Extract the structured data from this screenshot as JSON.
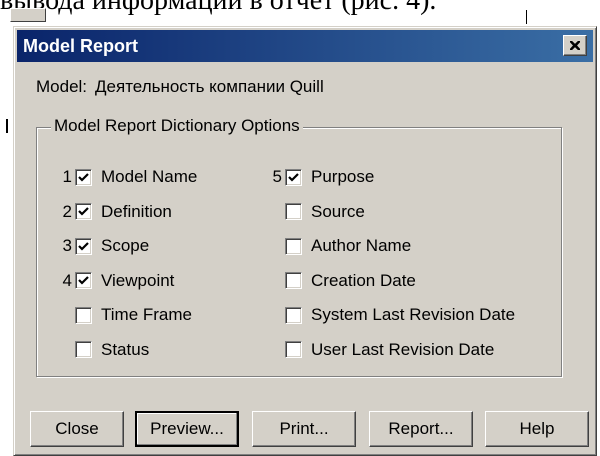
{
  "background": {
    "doc_text": "вывода информации в отчет (рис. 4)."
  },
  "dialog": {
    "title": "Model Report",
    "model_label": "Model:",
    "model_value": "Деятельность компании Quill",
    "group_title": "Model Report Dictionary Options",
    "options_left": [
      {
        "num": "1",
        "label": "Model Name",
        "checked": true
      },
      {
        "num": "2",
        "label": "Definition",
        "checked": true
      },
      {
        "num": "3",
        "label": "Scope",
        "checked": true
      },
      {
        "num": "4",
        "label": "Viewpoint",
        "checked": true
      },
      {
        "num": "",
        "label": "Time Frame",
        "checked": false
      },
      {
        "num": "",
        "label": "Status",
        "checked": false
      }
    ],
    "options_right": [
      {
        "num": "5",
        "label": "Purpose",
        "checked": true
      },
      {
        "num": "",
        "label": "Source",
        "checked": false
      },
      {
        "num": "",
        "label": "Author Name",
        "checked": false
      },
      {
        "num": "",
        "label": "Creation Date",
        "checked": false
      },
      {
        "num": "",
        "label": "System Last Revision Date",
        "checked": false
      },
      {
        "num": "",
        "label": "User Last Revision Date",
        "checked": false
      }
    ],
    "buttons": {
      "close": "Close",
      "preview": "Preview...",
      "print": "Print...",
      "report": "Report...",
      "help": "Help"
    }
  },
  "icons": {
    "window_close": "close-icon",
    "check": "checkmark-icon"
  },
  "colors": {
    "titlebar_start": "#0a246a",
    "titlebar_end": "#3a6ea5",
    "face": "#d4d0c8"
  }
}
